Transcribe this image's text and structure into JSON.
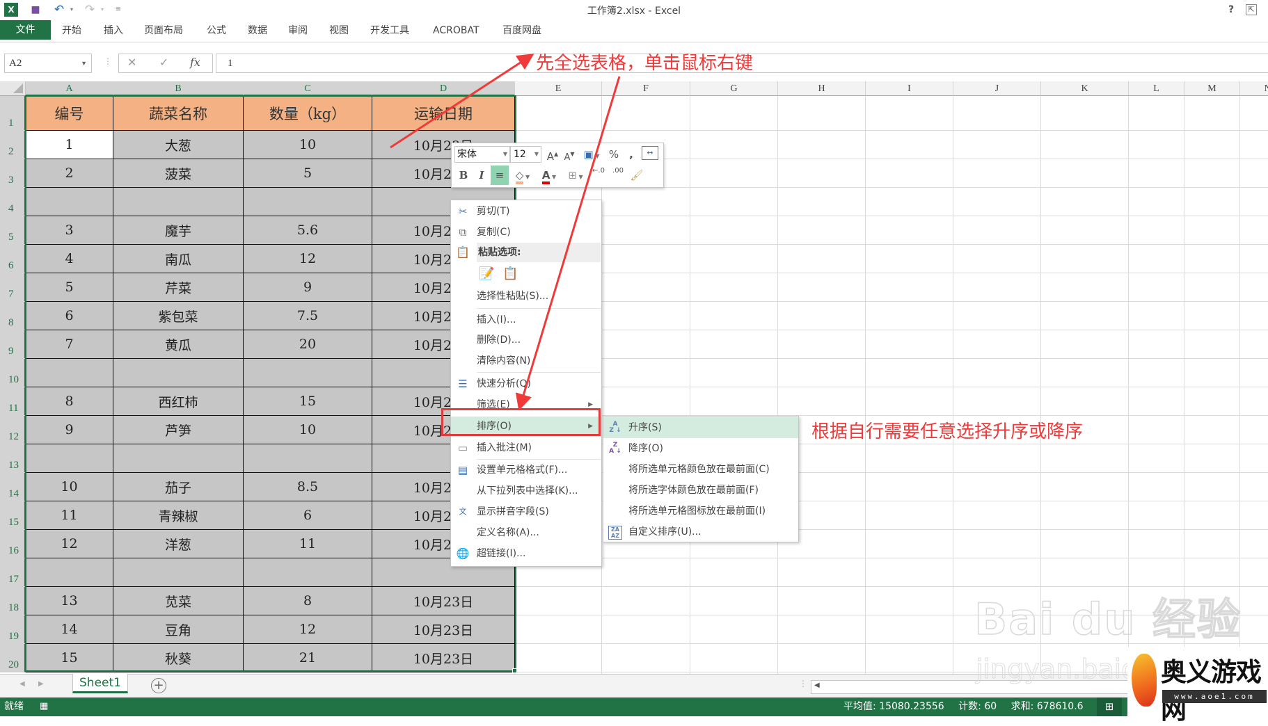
{
  "window": {
    "title": "工作簿2.xlsx - Excel",
    "help_label": "?",
    "ribbon_display_label": "⇱"
  },
  "quick_access": {
    "app_icon": "excel-icon",
    "save_icon": "save-icon",
    "undo_icon": "undo-icon",
    "redo_icon": "redo-icon",
    "customize_icon": "customize-icon"
  },
  "ribbon": {
    "tabs": [
      "文件",
      "开始",
      "插入",
      "页面布局",
      "公式",
      "数据",
      "审阅",
      "视图",
      "开发工具",
      "ACROBAT",
      "百度网盘"
    ]
  },
  "formula_bar": {
    "name_box": "A2",
    "cancel": "✕",
    "enter": "✓",
    "fx": "fx",
    "value": "1"
  },
  "grid": {
    "columns": [
      "A",
      "B",
      "C",
      "D",
      "E",
      "F",
      "G",
      "H",
      "I",
      "J",
      "K",
      "L",
      "M",
      "N"
    ],
    "rows": [
      "1",
      "2",
      "3",
      "4",
      "5",
      "6",
      "7",
      "8",
      "9",
      "10",
      "11",
      "12",
      "13",
      "14",
      "15",
      "16",
      "17",
      "18",
      "19",
      "20"
    ],
    "header": [
      "编号",
      "蔬菜名称",
      "数量（kg）",
      "运输日期"
    ],
    "data": [
      [
        "1",
        "大葱",
        "10",
        "10月23日"
      ],
      [
        "2",
        "菠菜",
        "5",
        "10月23日"
      ],
      [
        "",
        "",
        "",
        ""
      ],
      [
        "3",
        "魔芋",
        "5.6",
        "10月23日"
      ],
      [
        "4",
        "南瓜",
        "12",
        "10月23日"
      ],
      [
        "5",
        "芹菜",
        "9",
        "10月23日"
      ],
      [
        "6",
        "紫包菜",
        "7.5",
        "10月23日"
      ],
      [
        "7",
        "黄瓜",
        "20",
        "10月23日"
      ],
      [
        "",
        "",
        "",
        ""
      ],
      [
        "8",
        "西红柿",
        "15",
        "10月23日"
      ],
      [
        "9",
        "芦笋",
        "10",
        "10月23日"
      ],
      [
        "",
        "",
        "",
        ""
      ],
      [
        "10",
        "茄子",
        "8.5",
        "10月23日"
      ],
      [
        "11",
        "青辣椒",
        "6",
        "10月23日"
      ],
      [
        "12",
        "洋葱",
        "11",
        "10月23日"
      ],
      [
        "",
        "",
        "",
        ""
      ],
      [
        "13",
        "苋菜",
        "8",
        "10月23日"
      ],
      [
        "14",
        "豆角",
        "12",
        "10月23日"
      ],
      [
        "15",
        "秋葵",
        "21",
        "10月23日"
      ]
    ],
    "active_cell": "A2"
  },
  "mini_toolbar": {
    "font": "宋体",
    "size": "12",
    "grow_font": "A",
    "shrink_font": "A",
    "percent": "%",
    "comma": ",",
    "bold": "B",
    "italic": "I",
    "font_color": "A",
    "inc_decimal": "←.0",
    "dec_decimal": ".00",
    "colors": {
      "fill": "#f4b183",
      "font": "#e00000",
      "center_active": "#8fd3b0"
    }
  },
  "context_menu": {
    "items": [
      {
        "label": "剪切(T)",
        "icon": "scissors-icon"
      },
      {
        "label": "复制(C)",
        "icon": "copy-icon"
      },
      {
        "label": "粘贴选项:",
        "icon": "paste-icon"
      },
      {
        "label": "选择性粘贴(S)...",
        "icon": ""
      },
      {
        "label": "插入(I)...",
        "icon": ""
      },
      {
        "label": "删除(D)...",
        "icon": ""
      },
      {
        "label": "清除内容(N)",
        "icon": ""
      },
      {
        "label": "快速分析(Q)",
        "icon": "quick-analysis-icon"
      },
      {
        "label": "筛选(E)",
        "icon": ""
      },
      {
        "label": "排序(O)",
        "icon": ""
      },
      {
        "label": "插入批注(M)",
        "icon": "comment-icon"
      },
      {
        "label": "设置单元格格式(F)...",
        "icon": "format-cells-icon"
      },
      {
        "label": "从下拉列表中选择(K)...",
        "icon": ""
      },
      {
        "label": "显示拼音字段(S)",
        "icon": "pinyin-icon"
      },
      {
        "label": "定义名称(A)...",
        "icon": ""
      },
      {
        "label": "超链接(I)...",
        "icon": "hyperlink-icon"
      }
    ],
    "highlighted": "排序(O)"
  },
  "sort_submenu": {
    "items": [
      {
        "label": "升序(S)",
        "icon": "sort-ascending-icon"
      },
      {
        "label": "降序(O)",
        "icon": "sort-descending-icon"
      },
      {
        "label": "将所选单元格颜色放在最前面(C)",
        "icon": ""
      },
      {
        "label": "将所选字体颜色放在最前面(F)",
        "icon": ""
      },
      {
        "label": "将所选单元格图标放在最前面(I)",
        "icon": ""
      },
      {
        "label": "自定义排序(U)...",
        "icon": "custom-sort-icon"
      }
    ],
    "highlighted": "升序(S)"
  },
  "annotations": {
    "step1": "先全选表格，单击鼠标右键",
    "step2": "根据自行需要任意选择升序或降序",
    "color": "#f03a3a"
  },
  "sheets": {
    "tabs": [
      "Sheet1"
    ],
    "add_label": "+"
  },
  "status_bar": {
    "ready": "就绪",
    "average": "平均值: 15080.23556",
    "count": "计数: 60",
    "sum": "求和: 678610.6",
    "accent": "#217346"
  },
  "watermarks": {
    "baidu": "Bai du 经验",
    "baidu_url": "jingyan.baidu",
    "site_name": "奥义游戏网",
    "site_url": "www.aoe1.com"
  }
}
